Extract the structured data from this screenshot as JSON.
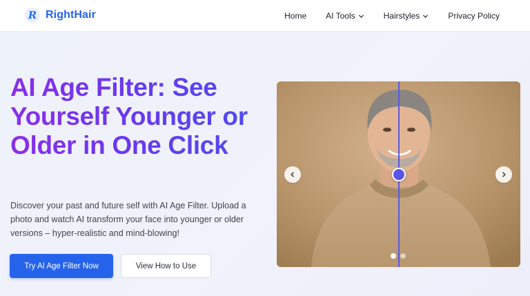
{
  "brand": {
    "logo_letter": "R",
    "name": "RightHair"
  },
  "nav": {
    "items": [
      {
        "label": "Home",
        "has_dropdown": false
      },
      {
        "label": "AI Tools",
        "has_dropdown": true
      },
      {
        "label": "Hairstyles",
        "has_dropdown": true
      },
      {
        "label": "Privacy Policy",
        "has_dropdown": false
      }
    ]
  },
  "hero": {
    "headline": "AI Age Filter: See Yourself Younger or Older in One Click",
    "description": "Discover your past and future self with AI Age Filter. Upload a photo and watch AI transform your face into younger or older versions – hyper-realistic and mind-blowing!",
    "primary_button": "Try AI Age Filter Now",
    "secondary_button": "View How to Use"
  },
  "slider": {
    "slide_count": 2,
    "active_slide": 1,
    "compare_position": 0.5,
    "icons": {
      "prev": "chevron-left-icon",
      "next": "chevron-right-icon"
    }
  },
  "colors": {
    "brand_blue": "#2563eb",
    "headline_gradient_start": "#8b2fe8",
    "headline_gradient_end": "#4b4ff0",
    "compare_handle": "#5a55e6"
  }
}
